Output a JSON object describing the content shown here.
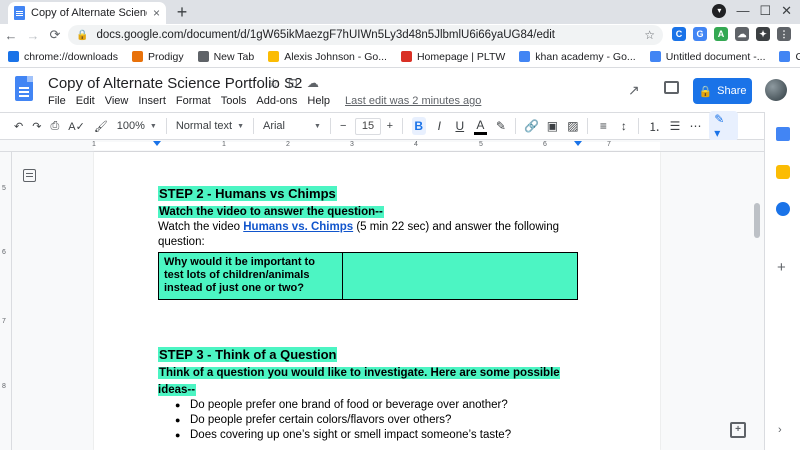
{
  "browser": {
    "tab_title": "Copy of Alternate Science Portfolio",
    "tab_close": "×",
    "new_tab": "+",
    "url": "docs.google.com/document/d/1gW65ikMaezgF7hUIWn5Ly3d48n5JlbmlU6i66yaUG84/edit",
    "back": "←",
    "forward": "→",
    "reload": "⟳",
    "bookmark_star": "☆",
    "window_min": "—",
    "window_max": "☐",
    "window_close": "✕",
    "extensions": [
      {
        "label": "C",
        "color": "#1a73e8"
      },
      {
        "label": "G",
        "color": "#4285f4"
      },
      {
        "label": "A",
        "color": "#34a853"
      },
      {
        "label": "☁",
        "color": "#5f6368"
      },
      {
        "label": "✦",
        "color": "#3c4043"
      },
      {
        "label": "⋮",
        "color": "#5f6368"
      }
    ]
  },
  "bookmarks": [
    {
      "label": "chrome://downloads",
      "icon": "download-icon",
      "color": "#1a73e8"
    },
    {
      "label": "Prodigy",
      "icon": "prodigy-icon",
      "color": "#e8710a"
    },
    {
      "label": "New Tab",
      "icon": "globe-icon",
      "color": "#5f6368"
    },
    {
      "label": "Alexis Johnson - Go...",
      "icon": "drive-icon",
      "color": "#fbbc04"
    },
    {
      "label": "Homepage | PLTW",
      "icon": "pltw-icon",
      "color": "#d93025"
    },
    {
      "label": "khan academy - Go...",
      "icon": "google-icon",
      "color": "#4285f4"
    },
    {
      "label": "Untitled document -...",
      "icon": "docs-icon",
      "color": "#4285f4"
    },
    {
      "label": "Google Docs",
      "icon": "docs-icon",
      "color": "#4285f4"
    }
  ],
  "docs": {
    "title": "Copy of Alternate Science Portfolio S2",
    "menu": [
      "File",
      "Edit",
      "View",
      "Insert",
      "Format",
      "Tools",
      "Add-ons",
      "Help"
    ],
    "last_edit": "Last edit was 2 minutes ago",
    "share_label": "Share"
  },
  "format_toolbar": {
    "zoom": "100%",
    "style": "Normal text",
    "font": "Arial",
    "font_size": "15",
    "minus": "−",
    "plus": "+",
    "bold": "B",
    "italic": "I",
    "underline": "U",
    "text_color": "A"
  },
  "ruler": {
    "h_numbers": [
      "1",
      "1",
      "2",
      "3",
      "4",
      "5",
      "6",
      "7"
    ],
    "v_numbers": [
      "5",
      "6",
      "7",
      "8"
    ]
  },
  "document": {
    "step2_heading": "STEP 2 - Humans vs Chimps",
    "step2_instruction": "Watch the video to answer the question--",
    "step2_body_before": "Watch the video ",
    "step2_link": "Humans vs. Chimps",
    "step2_body_after": " (5 min 22 sec) and answer the following question:",
    "table_question": "Why would it be important to test lots of children/animals instead of just one or two?",
    "table_answer": "",
    "step3_heading": "STEP 3 - Think of a Question",
    "step3_instruction": "Think of a question you would like to investigate. Here are some possible ideas--",
    "ideas": [
      "Do people prefer one brand of food or beverage over another?",
      "Do people prefer certain colors/flavors over others?",
      "Does covering up one’s sight or smell impact someone’s taste?"
    ]
  },
  "colors": {
    "highlight": "#4cf5c3",
    "share": "#1a73e8",
    "link": "#1155cc"
  }
}
